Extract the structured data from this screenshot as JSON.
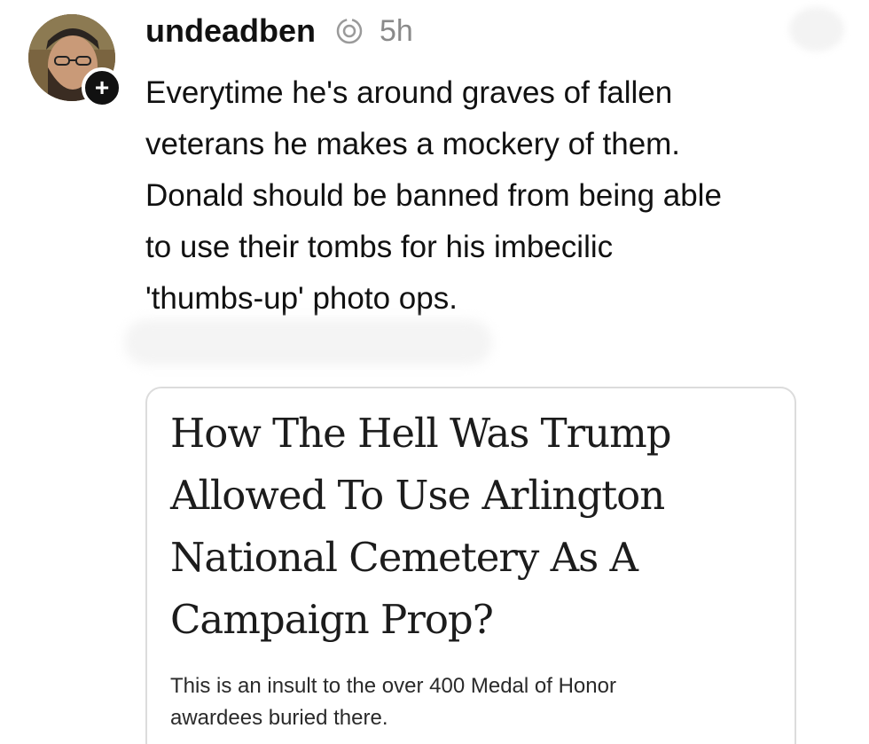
{
  "post": {
    "username": "undeadben",
    "thread_icon": "threads-icon",
    "timestamp": "5h",
    "follow_icon": "+",
    "text_lines": [
      "Everytime he's around graves of fallen",
      "veterans he makes a mockery of them.",
      "Donald should be banned from being able",
      "to use their tombs for his imbecilic",
      "'thumbs-up' photo ops."
    ]
  },
  "link_card": {
    "title_lines": [
      "How The Hell Was Trump",
      "Allowed To Use Arlington",
      "National Cemetery As A",
      "Campaign Prop?"
    ],
    "description_lines": [
      "This is an insult to the over 400 Medal of Honor",
      "awardees buried there."
    ]
  }
}
